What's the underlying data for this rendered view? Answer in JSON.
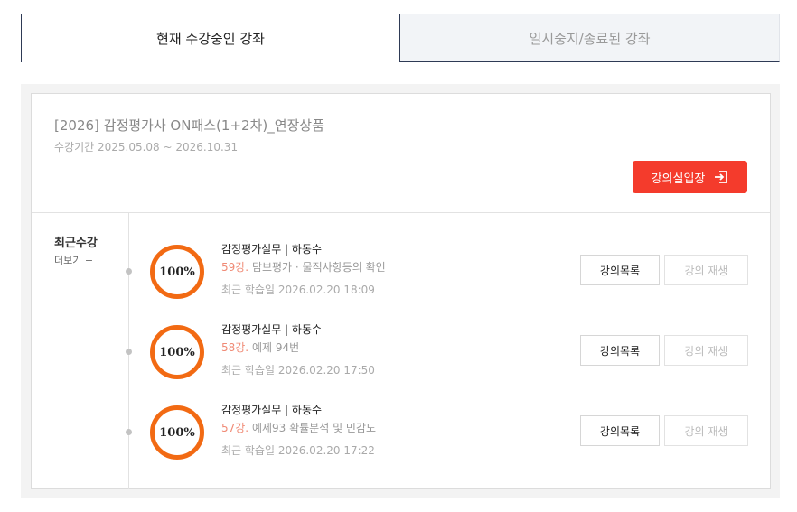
{
  "tabs": {
    "active": "현재 수강중인 강좌",
    "inactive": "일시중지/종료된 강좌"
  },
  "course": {
    "title": "[2026] 감정평가사 ON패스(1+2차)_연장상품",
    "period": "수강기간 2025.05.08 ~ 2026.10.31",
    "enter_label": "강의실입장"
  },
  "recent": {
    "label": "최근수강",
    "more": "더보기 +"
  },
  "lectures": [
    {
      "progress": "100%",
      "title": "감정평가실무 | 하동수",
      "num": "59강.",
      "desc": " 담보평가 · 물적사항등의 확인",
      "date": "최근 학습일 2026.02.20 18:09",
      "list_label": "강의목록",
      "play_label": "강의 재생"
    },
    {
      "progress": "100%",
      "title": "감정평가실무 | 하동수",
      "num": "58강.",
      "desc": " 예제 94번",
      "date": "최근 학습일 2026.02.20 17:50",
      "list_label": "강의목록",
      "play_label": "강의 재생"
    },
    {
      "progress": "100%",
      "title": "감정평가실무 | 하동수",
      "num": "57강.",
      "desc": " 예제93 확률분석 및 민감도",
      "date": "최근 학습일 2026.02.20 17:22",
      "list_label": "강의목록",
      "play_label": "강의 재생"
    }
  ],
  "colors": {
    "accent": "#f43b2c",
    "progress_ring": "#f26a13",
    "tab_border": "#2e3a55"
  },
  "icons": {
    "enter": "enter-icon"
  }
}
